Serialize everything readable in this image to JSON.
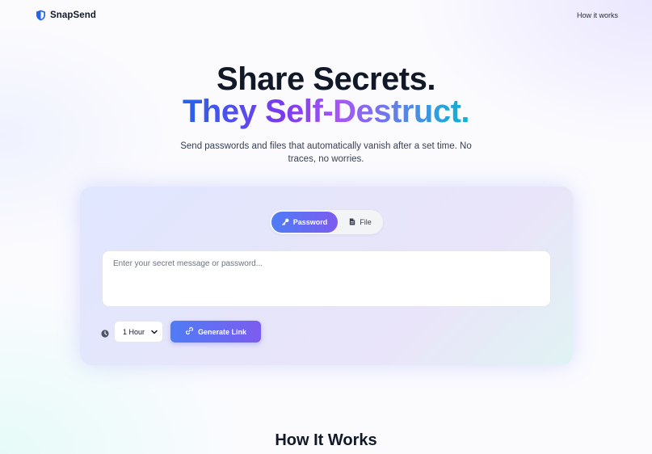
{
  "header": {
    "brand": "SnapSend",
    "nav_link": "How it works"
  },
  "hero": {
    "title_line1": "Share Secrets.",
    "title_line2": "They Self-Destruct.",
    "subtitle": "Send passwords and files that automatically vanish after a set time. No traces, no worries."
  },
  "form": {
    "tabs": [
      {
        "label": "Password",
        "icon": "key-icon",
        "active": true
      },
      {
        "label": "File",
        "icon": "file-icon",
        "active": false
      }
    ],
    "secret_placeholder": "Enter your secret message or password...",
    "expiry_selected": "1 Hour",
    "generate_label": "Generate Link"
  },
  "how_it_works": {
    "title": "How It Works"
  },
  "colors": {
    "accent_start": "#4f7cf5",
    "accent_end": "#7c5cf0",
    "brand_icon": "#2563eb"
  }
}
